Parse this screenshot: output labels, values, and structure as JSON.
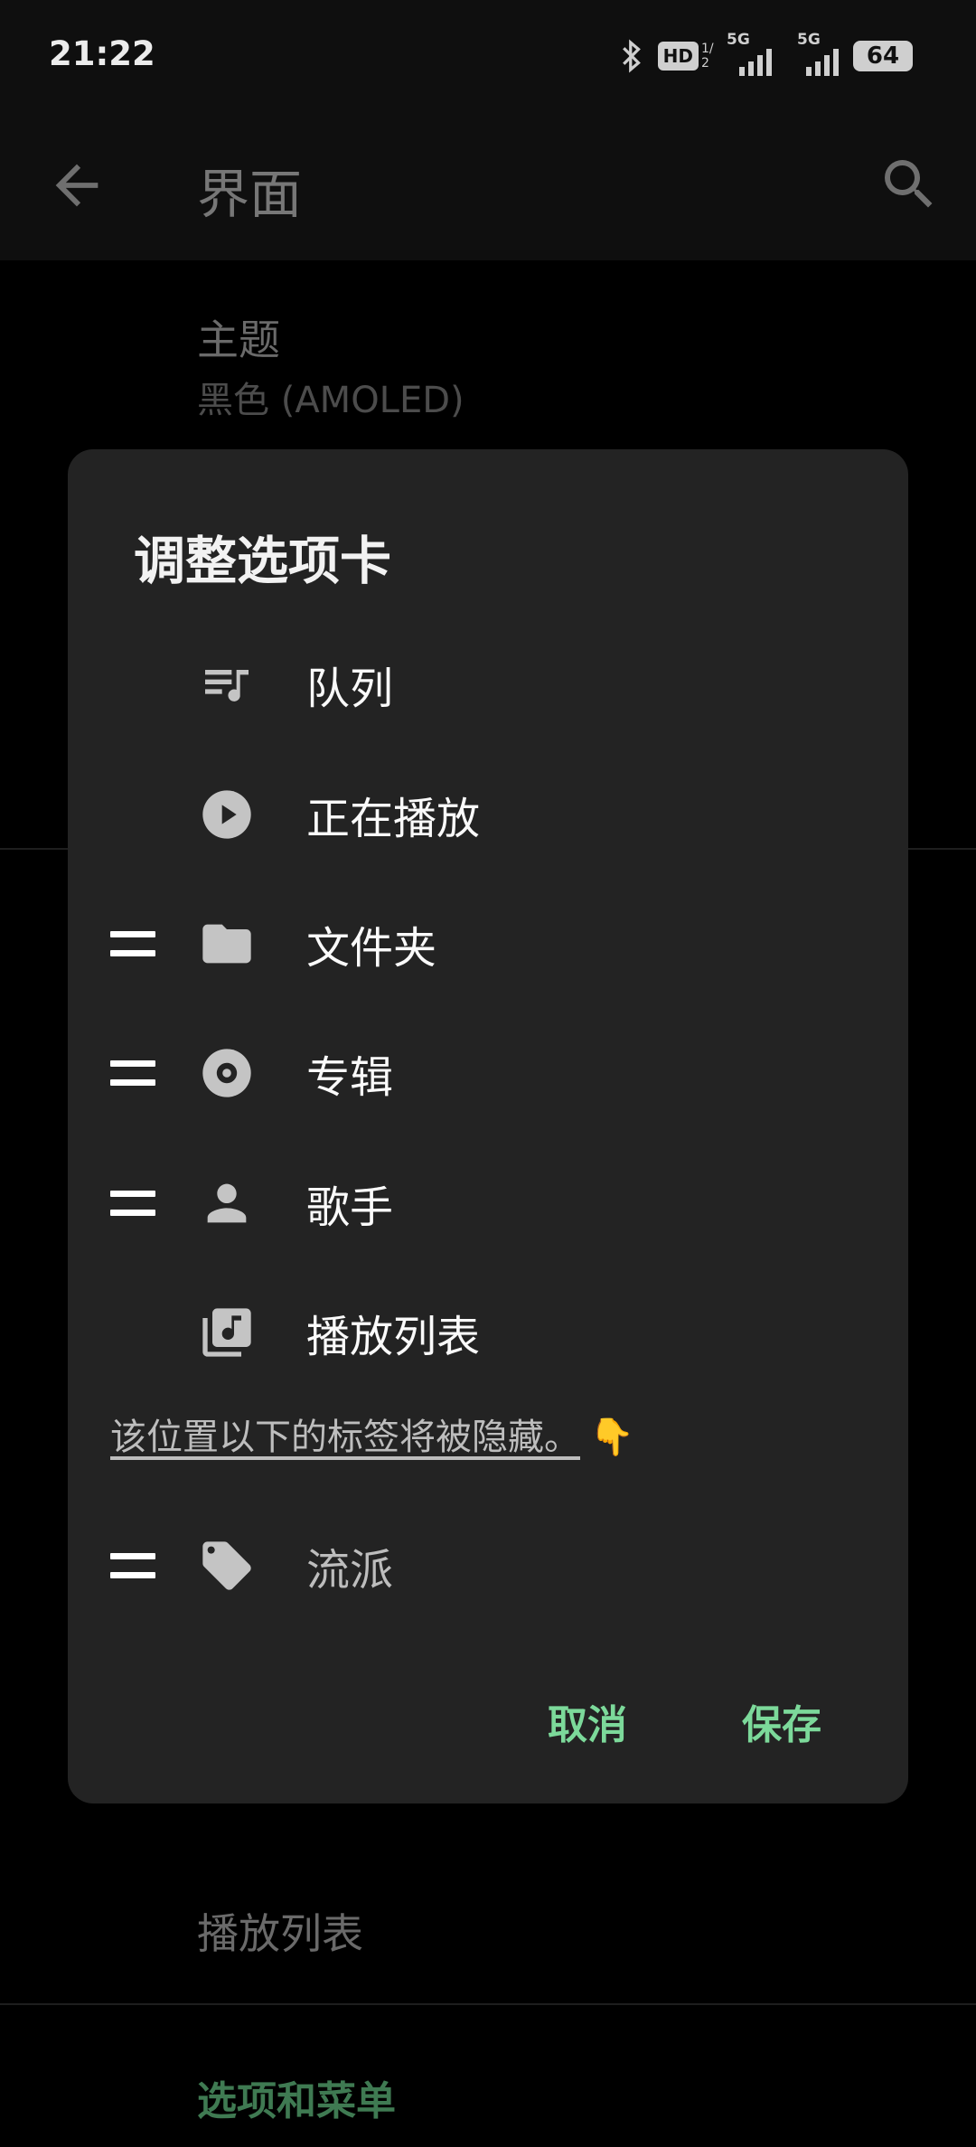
{
  "status_bar": {
    "time": "21:22",
    "hd_badge": "HD",
    "sim_fraction": "1/2",
    "network_1": "5G",
    "network_2": "5G",
    "battery": "64"
  },
  "app_bar": {
    "title": "界面",
    "back_icon": "arrow-back-icon",
    "search_icon": "search-icon"
  },
  "background_list": {
    "theme_title": "主题",
    "theme_value": "黑色 (AMOLED)",
    "playlist_item": "播放列表",
    "section_header": "选项和菜单"
  },
  "dialog": {
    "title": "调整选项卡",
    "tabs": [
      {
        "label": "队列",
        "icon": "queue-music-icon",
        "draggable": false
      },
      {
        "label": "正在播放",
        "icon": "play-circle-icon",
        "draggable": false
      },
      {
        "label": "文件夹",
        "icon": "folder-icon",
        "draggable": true
      },
      {
        "label": "专辑",
        "icon": "album-icon",
        "draggable": true
      },
      {
        "label": "歌手",
        "icon": "person-icon",
        "draggable": true
      },
      {
        "label": "播放列表",
        "icon": "library-music-icon",
        "draggable": false
      }
    ],
    "hidden_note": "该位置以下的标签将被隐藏。",
    "hidden_note_emoji": "👇",
    "hidden_tabs": [
      {
        "label": "流派",
        "icon": "tag-icon",
        "draggable": true
      }
    ],
    "cancel_label": "取消",
    "save_label": "保存"
  },
  "colors": {
    "accent": "#7cd99a",
    "dialog_bg": "#232323",
    "section_header": "#3f7a52"
  }
}
